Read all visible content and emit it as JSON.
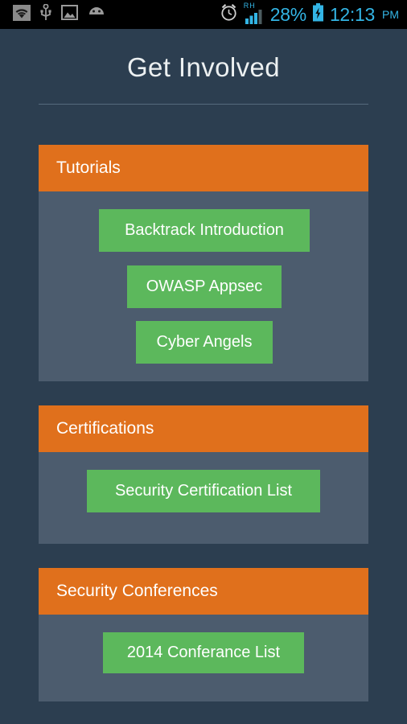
{
  "status_bar": {
    "left_icons": [
      {
        "name": "wifi-icon",
        "label": "wifi"
      },
      {
        "name": "usb-icon",
        "label": "usb"
      },
      {
        "name": "screenshot-image-icon",
        "label": "screenshot"
      },
      {
        "name": "android-robot-icon",
        "label": "android"
      }
    ],
    "alarm_icon": "alarm-clock-icon",
    "signal_label": "RH",
    "signal_icon": "cellular-signal-icon",
    "battery_percent": "28%",
    "battery_icon": "battery-charging-icon",
    "time": "12:13",
    "ampm": "PM"
  },
  "header": {
    "title": "Get Involved"
  },
  "colors": {
    "page_background": "#2c3e50",
    "card_body": "#4c5c6e",
    "card_header_orange": "#e0701c",
    "button_green": "#5cb85c",
    "divider": "#566a7d",
    "title_text": "#ecf0f1",
    "status_accent": "#33b5e5"
  },
  "cards": [
    {
      "title": "Tutorials",
      "buttons": [
        {
          "label": "Backtrack Introduction"
        },
        {
          "label": "OWASP Appsec"
        },
        {
          "label": "Cyber Angels"
        }
      ]
    },
    {
      "title": "Certifications",
      "buttons": [
        {
          "label": "Security Certification List"
        }
      ]
    },
    {
      "title": "Security Conferences",
      "buttons": [
        {
          "label": "2014 Conferance List"
        }
      ]
    }
  ]
}
